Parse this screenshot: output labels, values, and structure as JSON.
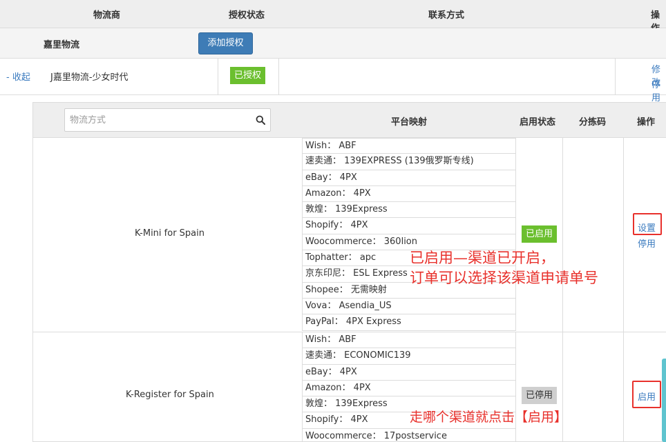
{
  "header": {
    "carrier": "物流商",
    "auth_status": "授权状态",
    "contact": "联系方式",
    "operation": "操作"
  },
  "carrier_row": {
    "name": "嘉里物流",
    "add_auth_label": "添加授权"
  },
  "account_row": {
    "collapse_label": "- 收起",
    "account_name": "J嘉里物流-少女时代",
    "auth_badge": "已授权",
    "edit_label": "修改",
    "disable_label": "停用"
  },
  "sub_table": {
    "search_placeholder": "物流方式",
    "col_mapping": "平台映射",
    "col_status": "启用状态",
    "col_sort_code": "分拣码",
    "col_operation": "操作"
  },
  "channels": [
    {
      "name": "K-Mini for Spain",
      "status": "已启用",
      "actions": [
        "设置",
        "停用"
      ],
      "mappings": [
        "Wish： ABF",
        "速卖通： 139EXPRESS (139俄罗斯专线)",
        "eBay： 4PX",
        "Amazon： 4PX",
        "敦煌： 139Express",
        "Shopify： 4PX",
        "Woocommerce： 360lion",
        "Tophatter： apc",
        "京东印尼： ESL Express",
        "Shopee： 无需映射",
        "Vova： Asendia_US",
        "PayPal： 4PX Express"
      ]
    },
    {
      "name": "K-Register for Spain",
      "status": "已停用",
      "actions": [
        "启用"
      ],
      "mappings": [
        "Wish： ABF",
        "速卖通： ECONOMIC139",
        "eBay： 4PX",
        "Amazon： 4PX",
        "敦煌： 139Express",
        "Shopify： 4PX",
        "Woocommerce： 17postservice"
      ]
    }
  ],
  "annotations": {
    "enabled_note_line1": "已启用—渠道已开启，",
    "enabled_note_line2": "订单可以选择该渠道申请单号",
    "enable_note": "走哪个渠道就点击【启用】"
  },
  "colors": {
    "primary_button": "#3e7cb6",
    "enabled_green": "#6bbf2e",
    "disabled_gray": "#cfcfcf",
    "annotation_red": "#e8302b",
    "link_blue": "#3b7bbf"
  }
}
